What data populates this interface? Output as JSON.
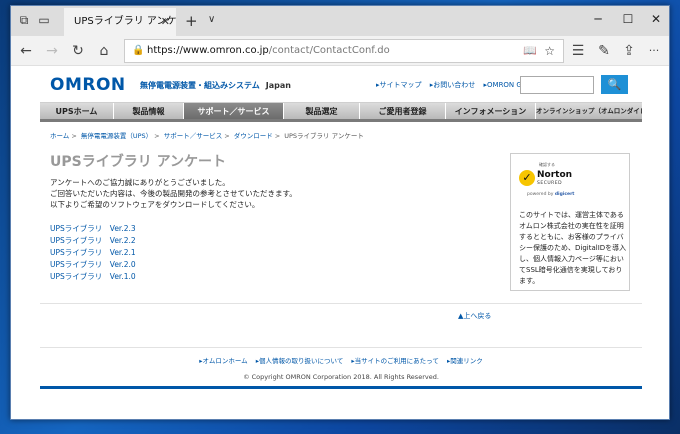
{
  "browser": {
    "tab_title": "UPSライブラリ アンケート |",
    "tab_close": "✕",
    "new_tab": "+",
    "tab_menu": "∨",
    "minimize": "─",
    "maximize": "☐",
    "close": "✕",
    "url_host": "https://www.omron.co.jp",
    "url_path": "/contact/ContactConf.do",
    "back": "←",
    "forward": "→",
    "refresh": "↻",
    "home": "⌂",
    "more": "···"
  },
  "site": {
    "logo": "OMRON",
    "tagline": "無停電電源装置・組込みシステム",
    "region": "Japan",
    "top_links": [
      "▸サイトマップ",
      "▸お問い合わせ",
      "▸OMRON Global"
    ],
    "search_button": "🔍",
    "nav": [
      {
        "label": "UPSホーム"
      },
      {
        "label": "製品情報"
      },
      {
        "label": "サポート／サービス"
      },
      {
        "label": "製品選定"
      },
      {
        "label": "ご愛用者登録"
      },
      {
        "label": "インフォメーション"
      },
      {
        "label": "オンラインショップ（オムロンダイレクト）"
      }
    ],
    "breadcrumb": [
      "ホーム",
      "無停電電源装置（UPS）",
      "サポート／サービス",
      "ダウンロード",
      "UPSライブラリ アンケート"
    ],
    "breadcrumb_sep": ">",
    "title": "UPSライブラリ アンケート",
    "intro": [
      "アンケートへのご協力誠にありがとうございました。",
      "ご回答いただいた内容は、今後の製品開発の参考とさせていただきます。",
      "以下よりご希望のソフトウェアをダウンロードしてください。"
    ],
    "downloads": [
      "UPSライブラリ　Ver.2.3",
      "UPSライブラリ　Ver.2.2",
      "UPSライブラリ　Ver.2.1",
      "UPSライブラリ　Ver.2.0",
      "UPSライブラリ　Ver.1.0"
    ],
    "norton": {
      "small": "確認する",
      "name": "Norton",
      "secured": "SECURED",
      "powered_by": "powered by",
      "vendor": "digicert",
      "text": "このサイトでは、運営主体であるオムロン株式会社の実在性を証明するとともに、お客様のプライバシー保護のため、DigitalIDを導入し、個人情報入力ページ等においてSSL暗号化通信を実現しております。"
    },
    "to_top": "▲上へ戻る",
    "footer_links": [
      "▸オムロンホーム",
      "▸個人情報の取り扱いについて",
      "▸当サイトのご利用にあたって",
      "▸関連リンク"
    ],
    "copyright": "© Copyright OMRON Corporation 2018. All Rights Reserved."
  }
}
